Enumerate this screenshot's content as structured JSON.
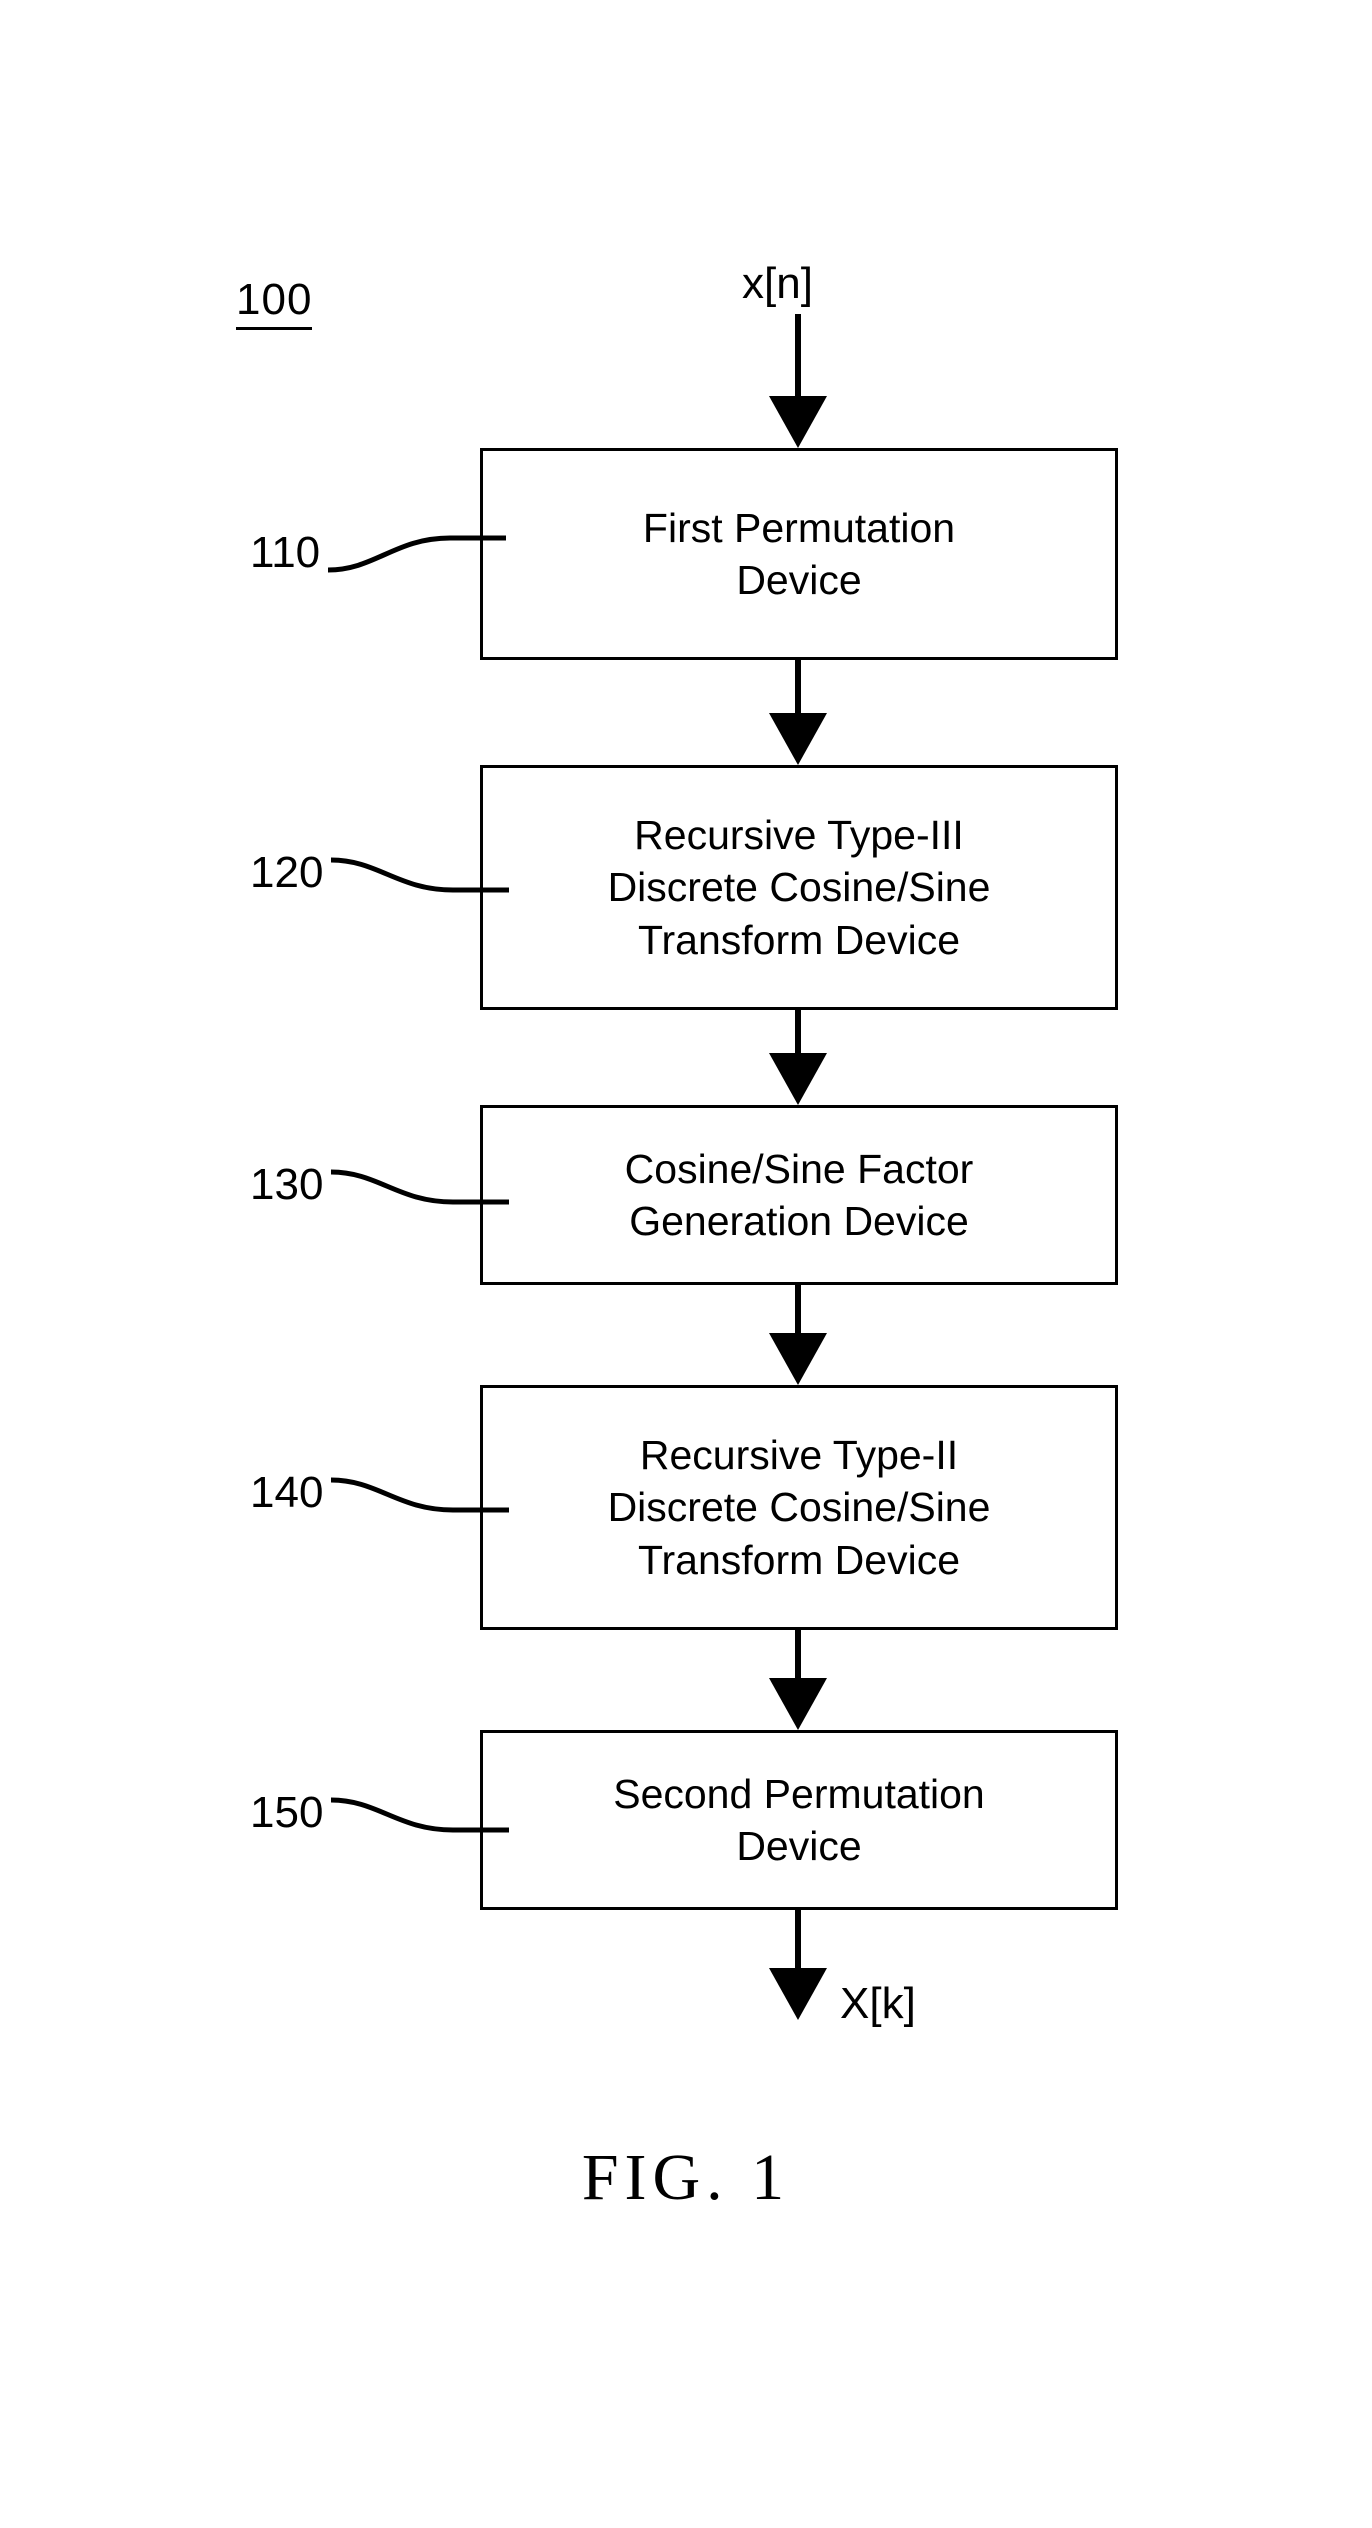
{
  "figure": {
    "number_label": "100",
    "caption": "FIG.  1",
    "input_signal": "x[n]",
    "output_signal": "X[k]"
  },
  "diagram": {
    "type": "flowchart",
    "orientation": "vertical",
    "blocks": [
      {
        "ref": "110",
        "label": "First Permutation\nDevice",
        "lines": [
          "First Permutation",
          "Device"
        ]
      },
      {
        "ref": "120",
        "label": "Recursive Type-III Discrete Cosine/Sine Transform Device",
        "lines": [
          "Recursive Type-III",
          "Discrete Cosine/Sine",
          "Transform Device"
        ]
      },
      {
        "ref": "130",
        "label": "Cosine/Sine Factor Generation Device",
        "lines": [
          "Cosine/Sine Factor",
          "Generation Device"
        ]
      },
      {
        "ref": "140",
        "label": "Recursive Type-II Discrete Cosine/Sine Transform Device",
        "lines": [
          "Recursive Type-II",
          "Discrete Cosine/Sine",
          "Transform Device"
        ]
      },
      {
        "ref": "150",
        "label": "Second Permutation Device",
        "lines": [
          "Second Permutation",
          "Device"
        ]
      }
    ],
    "connectors": [
      {
        "name": "input-arrow",
        "from": "x[n]",
        "to": "110"
      },
      {
        "name": "arrow-110-120",
        "from": "110",
        "to": "120"
      },
      {
        "name": "arrow-120-130",
        "from": "120",
        "to": "130"
      },
      {
        "name": "arrow-130-140",
        "from": "130",
        "to": "140"
      },
      {
        "name": "arrow-140-150",
        "from": "140",
        "to": "150"
      },
      {
        "name": "output-arrow",
        "from": "150",
        "to": "X[k]"
      }
    ]
  },
  "blocks_text": {
    "b110_l1": "First Permutation",
    "b110_l2": "Device",
    "b120_l1": "Recursive Type-III",
    "b120_l2": "Discrete Cosine/Sine",
    "b120_l3": "Transform Device",
    "b130_l1": "Cosine/Sine Factor",
    "b130_l2": "Generation Device",
    "b140_l1": "Recursive Type-II",
    "b140_l2": "Discrete Cosine/Sine",
    "b140_l3": "Transform Device",
    "b150_l1": "Second Permutation",
    "b150_l2": "Device"
  },
  "refs": {
    "r110": "110",
    "r120": "120",
    "r130": "130",
    "r140": "140",
    "r150": "150"
  },
  "colors": {
    "ink": "#000000",
    "paper": "#ffffff"
  }
}
